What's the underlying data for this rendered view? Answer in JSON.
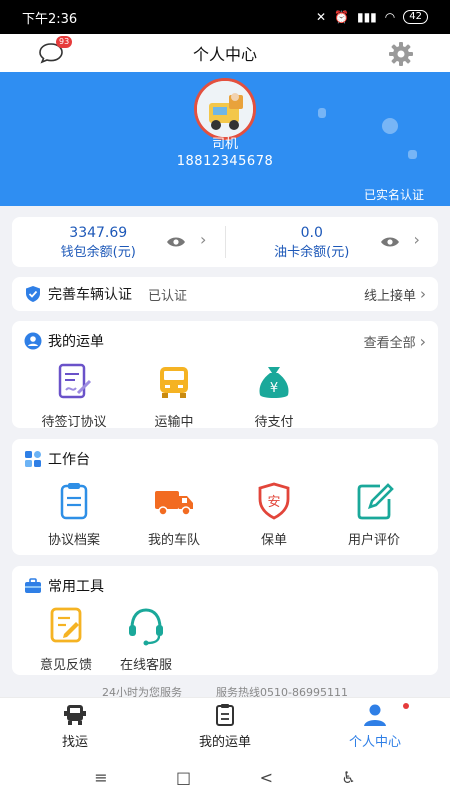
{
  "status_bar": {
    "time": "下午2:36",
    "battery": "42"
  },
  "header": {
    "title": "个人中心",
    "message_badge": "93"
  },
  "profile": {
    "role": "司机",
    "phone": "18812345678",
    "verified_label": "已实名认证"
  },
  "wallet": {
    "balance_value": "3347.69",
    "balance_label": "钱包余额(元)",
    "fuel_value": "0.0",
    "fuel_label": "油卡余额(元)"
  },
  "vehicle": {
    "label": "完善车辆认证",
    "status": "已认证",
    "online_label": "线上接单"
  },
  "orders": {
    "title": "我的运单",
    "view_all": "查看全部",
    "items": [
      {
        "label": "待签订协议",
        "icon": "contract-sign-icon"
      },
      {
        "label": "运输中",
        "icon": "truck-front-icon"
      },
      {
        "label": "待支付",
        "icon": "money-bag-icon"
      }
    ]
  },
  "workbench": {
    "title": "工作台",
    "items": [
      {
        "label": "协议档案",
        "icon": "clipboard-icon"
      },
      {
        "label": "我的车队",
        "icon": "truck-icon"
      },
      {
        "label": "保单",
        "icon": "shield-icon"
      },
      {
        "label": "用户评价",
        "icon": "edit-review-icon"
      }
    ]
  },
  "tools": {
    "title": "常用工具",
    "items": [
      {
        "label": "意见反馈",
        "icon": "feedback-icon"
      },
      {
        "label": "在线客服",
        "icon": "headset-icon"
      }
    ]
  },
  "footer": {
    "service_hours": "24小时为您服务",
    "hotline": "服务热线0510-86995111"
  },
  "tabs": [
    {
      "label": "找运",
      "icon": "truck-tab-icon"
    },
    {
      "label": "我的运单",
      "icon": "document-tab-icon"
    },
    {
      "label": "个人中心",
      "icon": "person-tab-icon"
    }
  ],
  "nav": {
    "menu": "≡",
    "home": "□",
    "back": "<",
    "accessibility": "♿"
  },
  "colors": {
    "primary": "#2f8ef2",
    "accent_orange": "#f5a623",
    "teal": "#1aa89a",
    "red": "#e53b3b"
  }
}
